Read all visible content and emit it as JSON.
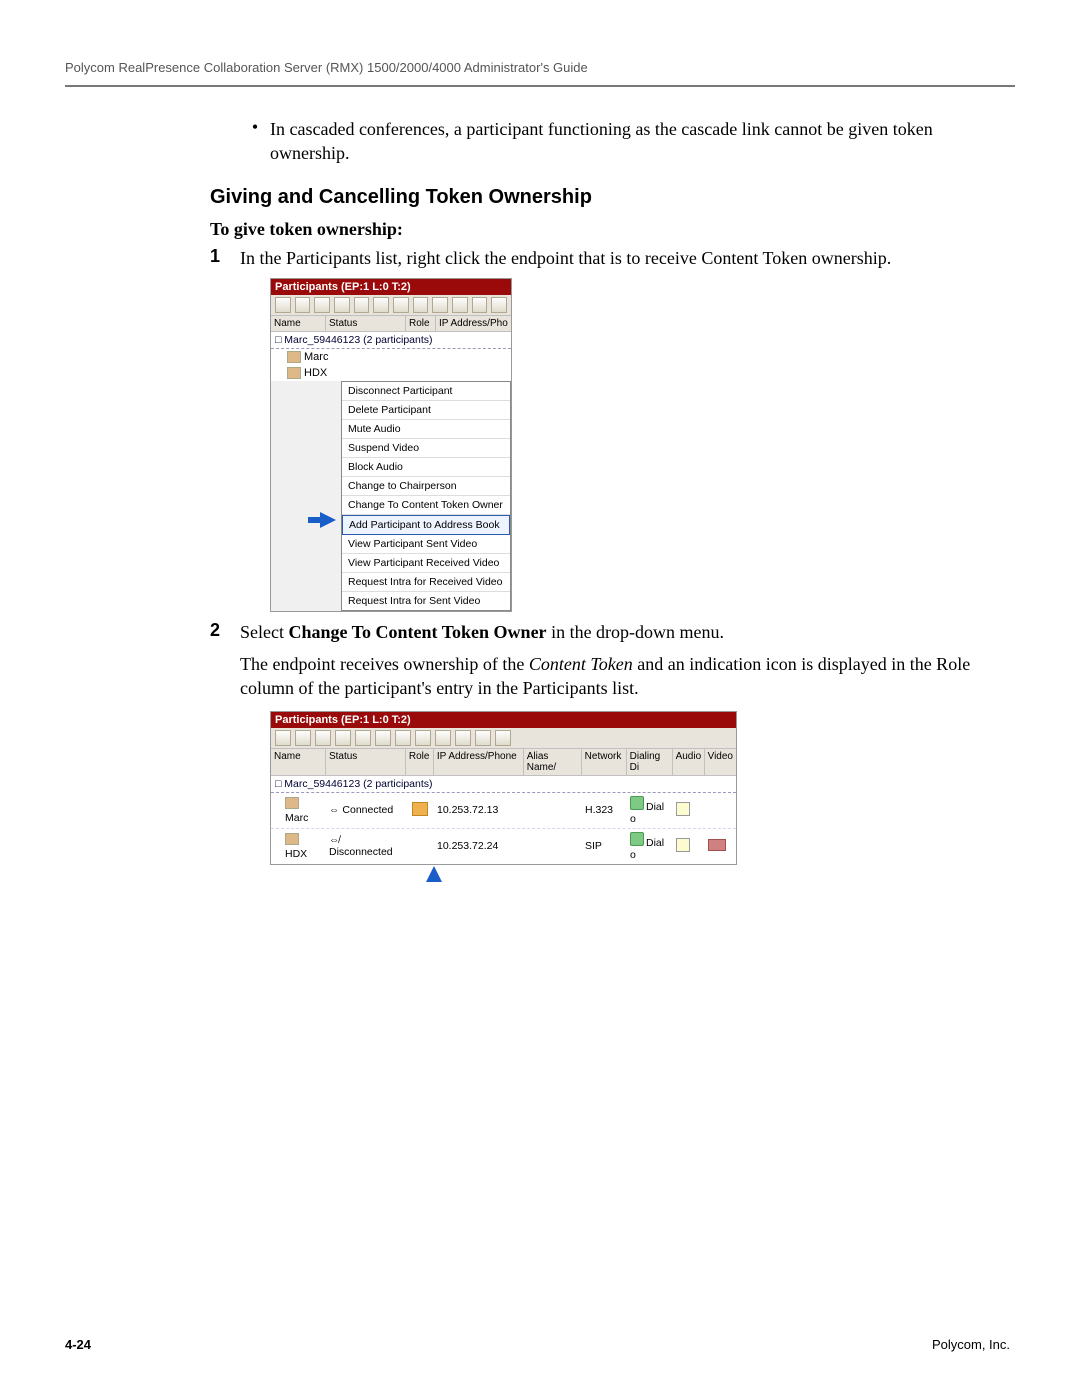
{
  "header": "Polycom RealPresence Collaboration Server (RMX) 1500/2000/4000 Administrator's Guide",
  "bullet_note": "In cascaded conferences, a participant functioning as the cascade link cannot be given token ownership.",
  "section_title": "Giving and Cancelling Token Ownership",
  "sub_head": "To give token ownership:",
  "step1_num": "1",
  "step1_text": "In the Participants list, right click the endpoint that is to receive Content Token ownership.",
  "step2_num": "2",
  "step2_prefix": "Select ",
  "step2_bold": "Change To Content Token Owner",
  "step2_suffix": " in the drop-down menu.",
  "step2_para_a": "The endpoint receives ownership of the ",
  "step2_para_ital": "Content Token",
  "step2_para_b": " and an indication icon is displayed in the Role column of the participant's entry in the Participants list.",
  "panel1": {
    "title": "Participants (EP:1 L:0 T:2)",
    "cols": {
      "name": "Name",
      "status": "Status",
      "role": "Role",
      "ip": "IP Address/Pho"
    },
    "group": "Marc_59446123 (2  participants)",
    "rows": [
      {
        "name": "Marc"
      },
      {
        "name": "HDX"
      }
    ],
    "menu": [
      "Disconnect Participant",
      "Delete Participant",
      "Mute Audio",
      "Suspend Video",
      "Block Audio",
      "Change to Chairperson",
      "Change To Content Token Owner",
      "Add Participant to Address Book",
      "View Participant Sent Video",
      "View Participant Received Video",
      "Request Intra for Received Video",
      "Request Intra for Sent Video"
    ],
    "menu_highlight_index": 7
  },
  "panel2": {
    "title": "Participants (EP:1 L:0 T:2)",
    "cols": {
      "name": "Name",
      "status": "Status",
      "role": "Role",
      "ip": "IP Address/Phone",
      "alias": "Alias Name/",
      "network": "Network",
      "dialing": "Dialing Di",
      "audio": "Audio",
      "video": "Video"
    },
    "group": "Marc_59446123 (2  participants)",
    "rows": [
      {
        "name": "Marc",
        "status": "Connected",
        "role_icon": true,
        "ip": "10.253.72.13",
        "network": "H.323",
        "dialing": "Dial o",
        "audio": true,
        "video": false
      },
      {
        "name": "HDX",
        "status": "Disconnected",
        "role_icon": false,
        "ip": "10.253.72.24",
        "network": "SIP",
        "dialing": "Dial o",
        "audio": true,
        "video": true
      }
    ]
  },
  "footer": {
    "page": "4-24",
    "company": "Polycom, Inc."
  }
}
